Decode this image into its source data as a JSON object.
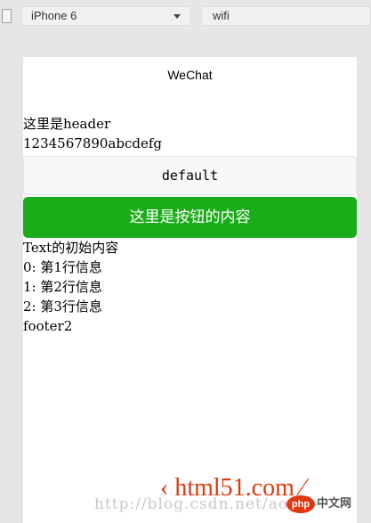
{
  "toolbar": {
    "device": "iPhone 6",
    "network": "wifi"
  },
  "page": {
    "nav_title": "WeChat",
    "header": "这里是header",
    "text_line": "1234567890abcdefg",
    "default_button": "default",
    "primary_button": "这里是按钮的内容",
    "text_initial": "Text的初始内容",
    "list": [
      "0: 第1行信息",
      "1: 第2行信息",
      "2: 第3行信息"
    ],
    "footer": "footer2"
  },
  "watermark": {
    "url": "http://blog.csdn.net/ao",
    "logo": "‹ html51.com ⁄",
    "badge": "php",
    "site": "中文网"
  },
  "colors": {
    "primary_button": "#1aad19",
    "watermark_red": "#e2380f"
  }
}
